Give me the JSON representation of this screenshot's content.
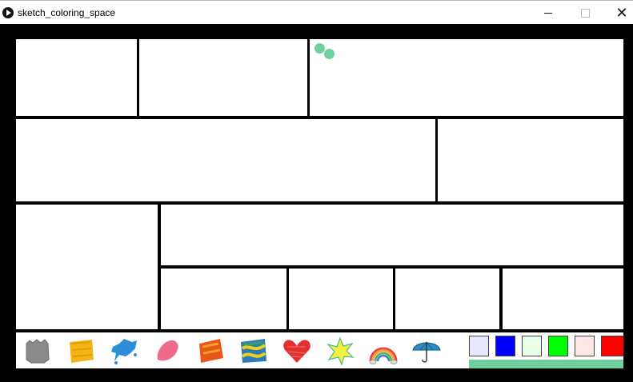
{
  "window": {
    "title": "sketch_coloring_space"
  },
  "brushes": [
    {
      "name": "gray-paint-icon",
      "color": "#8a8a8a"
    },
    {
      "name": "yellow-paint-icon",
      "color": "#f2b418"
    },
    {
      "name": "blue-splash-icon",
      "color": "#2a8fd8"
    },
    {
      "name": "pink-paint-icon",
      "color": "#f06a8a"
    },
    {
      "name": "orange-paint-icon",
      "color": "#e9561a"
    },
    {
      "name": "marble-pattern-icon",
      "color": "#2f7ab8"
    },
    {
      "name": "heart-icon",
      "color": "#e23030"
    },
    {
      "name": "star-icon",
      "color": "#f4f23a"
    },
    {
      "name": "rainbow-icon",
      "color": "#e44"
    },
    {
      "name": "umbrella-icon",
      "color": "#2b8fc8"
    }
  ],
  "swatches": [
    "#e6e6ff",
    "#0000ff",
    "#e9ffe9",
    "#00ff00",
    "#ffe6e6",
    "#ff0000"
  ],
  "colors": {
    "cursor_dots": "#6fcf9f",
    "selected_bar": "#6fcf9f"
  }
}
